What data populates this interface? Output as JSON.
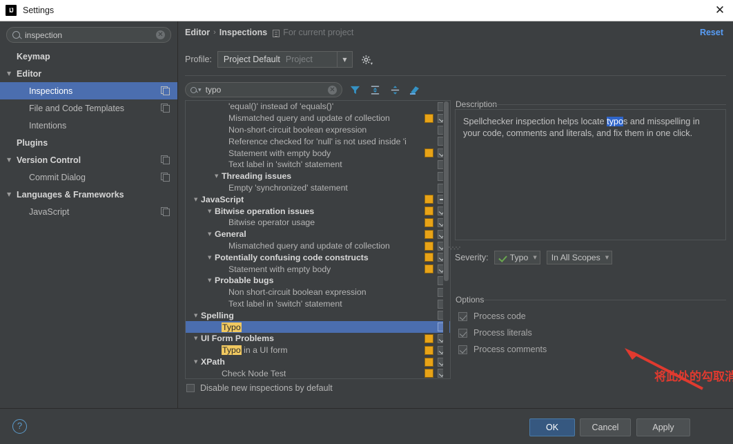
{
  "window": {
    "title": "Settings",
    "app_icon": "intellij-idea-icon",
    "close_label": "✕"
  },
  "sidebar": {
    "search": {
      "value": "inspection",
      "placeholder": "",
      "clear_label": "✕"
    },
    "items": [
      {
        "label": "Keymap",
        "level": 0,
        "arrow": "",
        "bold": true,
        "icon": ""
      },
      {
        "label": "Editor",
        "level": 0,
        "arrow": "▼",
        "bold": true,
        "icon": ""
      },
      {
        "label": "Inspections",
        "level": 1,
        "arrow": "",
        "bold": false,
        "icon": "copy-icon",
        "selected": true
      },
      {
        "label": "File and Code Templates",
        "level": 1,
        "arrow": "",
        "bold": false,
        "icon": "copy-icon"
      },
      {
        "label": "Intentions",
        "level": 1,
        "arrow": "",
        "bold": false,
        "icon": ""
      },
      {
        "label": "Plugins",
        "level": 0,
        "arrow": "",
        "bold": true,
        "icon": ""
      },
      {
        "label": "Version Control",
        "level": 0,
        "arrow": "▼",
        "bold": true,
        "icon": "copy-icon"
      },
      {
        "label": "Commit Dialog",
        "level": 1,
        "arrow": "",
        "bold": false,
        "icon": "copy-icon"
      },
      {
        "label": "Languages & Frameworks",
        "level": 0,
        "arrow": "▼",
        "bold": true,
        "icon": ""
      },
      {
        "label": "JavaScript",
        "level": 1,
        "arrow": "",
        "bold": false,
        "icon": "copy-icon"
      }
    ]
  },
  "header": {
    "breadcrumb_1": "Editor",
    "separator": "›",
    "breadcrumb_2": "Inspections",
    "scope_note": "For current project",
    "reset_label": "Reset"
  },
  "profile": {
    "label": "Profile:",
    "value": "Project Default",
    "value_suffix": "Project",
    "dropdown_glyph": "▼",
    "gear_icon": "gear-icon"
  },
  "toolbar": {
    "search": {
      "value": "typo",
      "placeholder": "",
      "clear_label": "✕"
    },
    "buttons": [
      {
        "name": "filter-icon",
        "title": "Filter inspections"
      },
      {
        "name": "expand-all-icon",
        "title": "Expand all"
      },
      {
        "name": "collapse-all-icon",
        "title": "Collapse all"
      },
      {
        "name": "reset-to-empty-icon",
        "title": "Reset to empty"
      }
    ]
  },
  "inspections": {
    "rows": [
      {
        "label": "'equal()' instead of 'equals()'",
        "indent": 5,
        "arrow": "",
        "group": false,
        "severity": false,
        "check": "off"
      },
      {
        "label": "Mismatched query and update of collection",
        "indent": 5,
        "arrow": "",
        "group": false,
        "severity": true,
        "check": "on"
      },
      {
        "label": "Non-short-circuit boolean expression",
        "indent": 5,
        "arrow": "",
        "group": false,
        "severity": false,
        "check": "off"
      },
      {
        "label": "Reference checked for 'null' is not used inside 'i",
        "indent": 5,
        "arrow": "",
        "group": false,
        "severity": false,
        "check": "off"
      },
      {
        "label": "Statement with empty body",
        "indent": 5,
        "arrow": "",
        "group": false,
        "severity": true,
        "check": "on"
      },
      {
        "label": "Text label in 'switch' statement",
        "indent": 5,
        "arrow": "",
        "group": false,
        "severity": false,
        "check": "off"
      },
      {
        "label": "Threading issues",
        "indent": 4,
        "arrow": "▼",
        "group": true,
        "severity": false,
        "check": "off"
      },
      {
        "label": "Empty 'synchronized' statement",
        "indent": 5,
        "arrow": "",
        "group": false,
        "severity": false,
        "check": "off"
      },
      {
        "label": "JavaScript",
        "indent": 1,
        "arrow": "▼",
        "group": true,
        "severity": true,
        "check": "mid"
      },
      {
        "label": "Bitwise operation issues",
        "indent": 3,
        "arrow": "▼",
        "group": true,
        "severity": true,
        "check": "on"
      },
      {
        "label": "Bitwise operator usage",
        "indent": 5,
        "arrow": "",
        "group": false,
        "severity": true,
        "check": "on"
      },
      {
        "label": "General",
        "indent": 3,
        "arrow": "▼",
        "group": true,
        "severity": true,
        "check": "on"
      },
      {
        "label": "Mismatched query and update of collection",
        "indent": 5,
        "arrow": "",
        "group": false,
        "severity": true,
        "check": "on"
      },
      {
        "label": "Potentially confusing code constructs",
        "indent": 3,
        "arrow": "▼",
        "group": true,
        "severity": true,
        "check": "on"
      },
      {
        "label": "Statement with empty body",
        "indent": 5,
        "arrow": "",
        "group": false,
        "severity": true,
        "check": "on"
      },
      {
        "label": "Probable bugs",
        "indent": 3,
        "arrow": "▼",
        "group": true,
        "severity": false,
        "check": "off"
      },
      {
        "label": "Non short-circuit boolean expression",
        "indent": 5,
        "arrow": "",
        "group": false,
        "severity": false,
        "check": "off"
      },
      {
        "label": "Text label in 'switch' statement",
        "indent": 5,
        "arrow": "",
        "group": false,
        "severity": false,
        "check": "off"
      },
      {
        "label": "Spelling",
        "indent": 1,
        "arrow": "▼",
        "group": true,
        "severity": false,
        "check": "off",
        "style": "spelling"
      },
      {
        "label": "Typo",
        "indent": 4,
        "arrow": "",
        "group": false,
        "severity": false,
        "check": "off",
        "selected": true,
        "highlight": "Typo"
      },
      {
        "label": "UI Form Problems",
        "indent": 1,
        "arrow": "▼",
        "group": true,
        "severity": true,
        "check": "on"
      },
      {
        "label": "Typo in a UI form",
        "indent": 4,
        "arrow": "",
        "group": false,
        "severity": true,
        "check": "on",
        "highlight": "Typo"
      },
      {
        "label": "XPath",
        "indent": 1,
        "arrow": "▼",
        "group": true,
        "severity": true,
        "check": "on"
      },
      {
        "label": "Check Node Test",
        "indent": 4,
        "arrow": "",
        "group": false,
        "severity": true,
        "check": "on"
      }
    ],
    "disable_new_label": "Disable new inspections by default",
    "disable_new_checked": false
  },
  "description": {
    "legend": "Description",
    "text_before": "Spellchecker inspection helps locate ",
    "text_selected": "typo",
    "text_after": "s and misspelling in your code, comments and literals, and fix them in one click."
  },
  "severity": {
    "label": "Severity:",
    "value": "Typo",
    "value_icon": "green-check-icon",
    "scope_value": "In All Scopes",
    "dropdown_glyph": "▼"
  },
  "options": {
    "legend": "Options",
    "items": [
      {
        "label": "Process code",
        "checked": true
      },
      {
        "label": "Process literals",
        "checked": true
      },
      {
        "label": "Process comments",
        "checked": true
      }
    ]
  },
  "annotation": {
    "text": "将此处的勾取消掉",
    "color": "#e03a2f",
    "arrow": "red-arrow-icon"
  },
  "footer": {
    "help_label": "?",
    "ok_label": "OK",
    "cancel_label": "Cancel",
    "apply_label": "Apply"
  },
  "colors": {
    "accent": "#4b6eaf",
    "link": "#589df6",
    "severity_swatch": "#e8a317",
    "highlight": "#f0c860",
    "annotation_red": "#e03a2f",
    "background": "#3c3f41"
  }
}
